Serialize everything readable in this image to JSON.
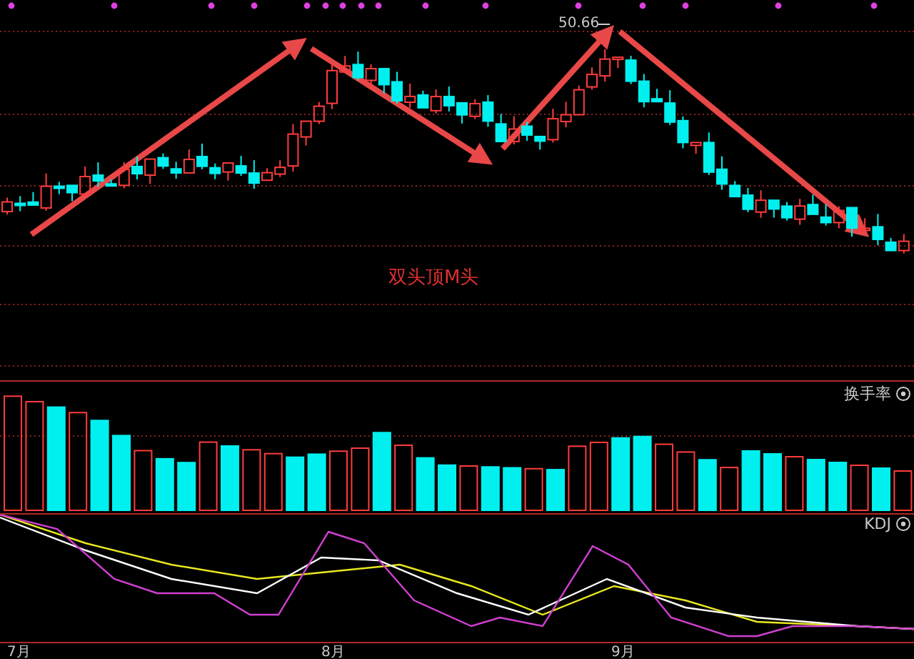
{
  "main_chart": {
    "peak_label": "50.66",
    "annotation": "双头顶M头"
  },
  "turnover_panel": {
    "title": "换手率"
  },
  "kdj_panel": {
    "title": "KDJ"
  },
  "time_axis": {
    "labels": [
      "7月",
      "8月",
      "9月"
    ]
  }
}
